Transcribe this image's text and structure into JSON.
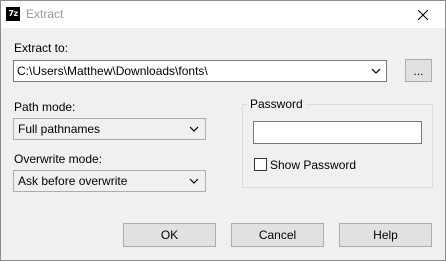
{
  "window": {
    "title": "Extract",
    "app_icon_text": "7z"
  },
  "extract_to": {
    "label": "Extract to:",
    "value": "C:\\Users\\Matthew\\Downloads\\fonts\\",
    "browse_label": "..."
  },
  "path_mode": {
    "label": "Path mode:",
    "selected": "Full pathnames"
  },
  "overwrite_mode": {
    "label": "Overwrite mode:",
    "selected": "Ask before overwrite"
  },
  "password": {
    "group_label": "Password",
    "value": "",
    "show_password_label": "Show Password",
    "show_password_checked": false
  },
  "buttons": {
    "ok": "OK",
    "cancel": "Cancel",
    "help": "Help"
  }
}
